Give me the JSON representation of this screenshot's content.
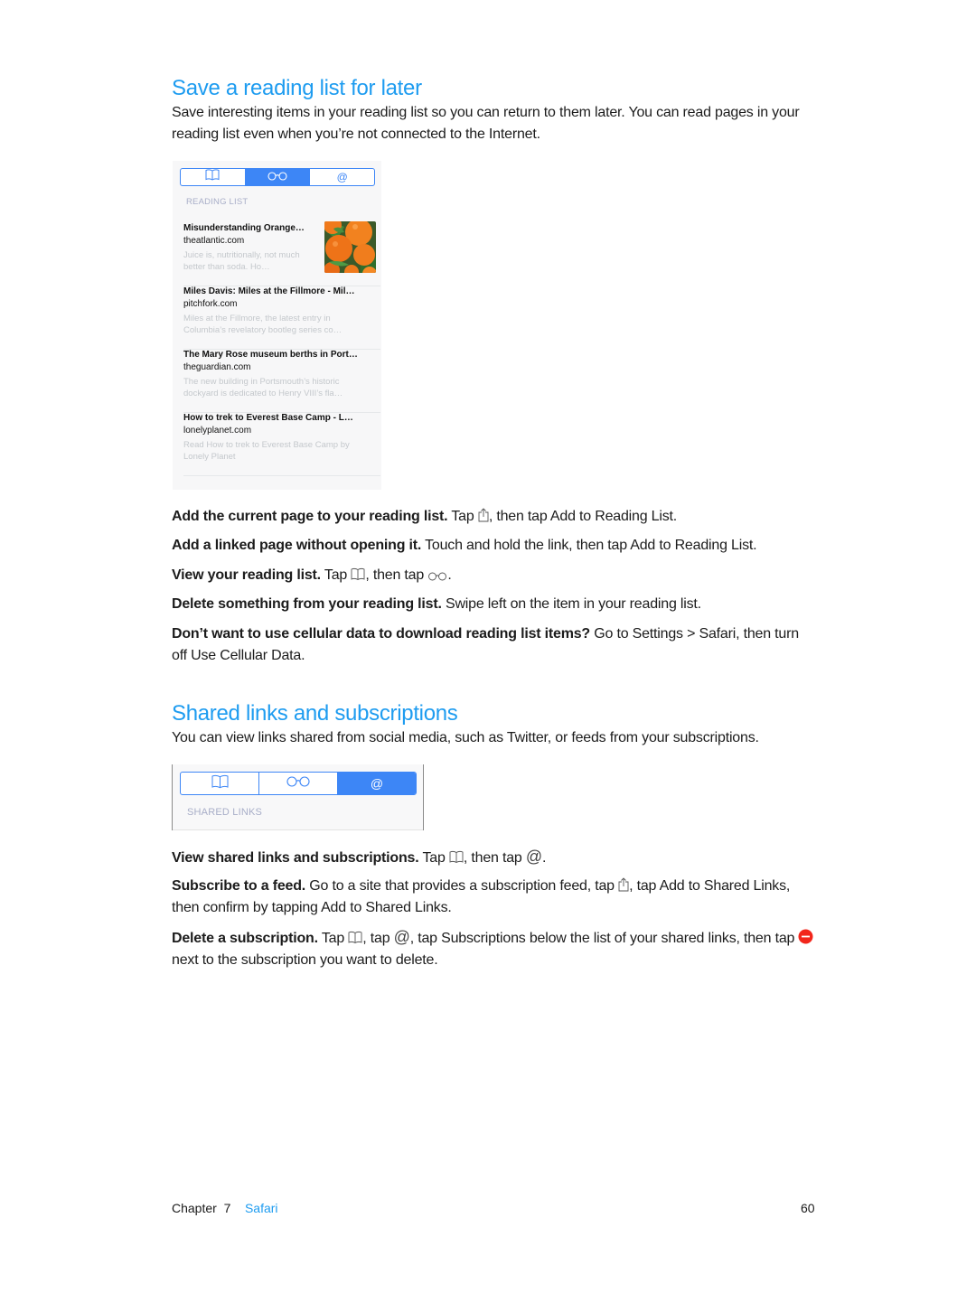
{
  "section1": {
    "title": "Save a reading list for later",
    "intro": "Save interesting items in your reading list so you can return to them later. You can read pages in your reading list even when you’re not connected to the Internet."
  },
  "reading_list_screen": {
    "tabs": [
      {
        "icon": "bookmarks-book-icon",
        "active": false
      },
      {
        "icon": "reading-list-glasses-icon",
        "active": true
      },
      {
        "icon": "shared-links-at-icon",
        "label": "@",
        "active": false
      }
    ],
    "section_label": "READING LIST",
    "items": [
      {
        "title": "Misunderstanding Orange…",
        "domain": "theatlantic.com",
        "snippet": "Juice is, nutritionally, not much better than soda. Ho…",
        "has_thumbnail": true
      },
      {
        "title": "Miles Davis: Miles at the Fillmore - Mil…",
        "domain": "pitchfork.com",
        "snippet": "Miles at the Fillmore, the latest entry in Columbia’s revelatory bootleg series co…",
        "has_thumbnail": false
      },
      {
        "title": "The Mary Rose museum berths in Port…",
        "domain": "theguardian.com",
        "snippet": "The new building in Portsmouth’s historic dockyard is dedicated to Henry VIII’s fla…",
        "has_thumbnail": false
      },
      {
        "title": "How to trek to Everest Base Camp - L…",
        "domain": "lonelyplanet.com",
        "snippet": "Read How to trek to Everest Base Camp by Lonely Planet",
        "has_thumbnail": false
      }
    ]
  },
  "tips1": [
    {
      "bold": "Add the current page to your reading list.",
      "pre": " Tap ",
      "icon": "share-icon",
      "post": ", then tap Add to Reading List."
    },
    {
      "bold": "Add a linked page without opening it.",
      "text": " Touch and hold the link, then tap Add to Reading List."
    },
    {
      "bold": "View your reading list.",
      "pre": " Tap ",
      "icon": "bookmarks-book-icon",
      "mid": ", then tap ",
      "icon2": "reading-list-glasses-icon",
      "post": "."
    },
    {
      "bold": "Delete something from your reading list.",
      "text": " Swipe left on the item in your reading list."
    },
    {
      "bold": "Don’t want to use cellular data to download reading list items?",
      "text": " Go to Settings > Safari, then turn off Use Cellular Data."
    }
  ],
  "section2": {
    "title": "Shared links and subscriptions",
    "intro": "You can view links shared from social media, such as Twitter, or feeds from your subscriptions."
  },
  "shared_links_screen": {
    "tabs": [
      {
        "icon": "bookmarks-book-icon",
        "active": false
      },
      {
        "icon": "reading-list-glasses-icon",
        "active": false
      },
      {
        "icon": "shared-links-at-icon",
        "label": "@",
        "active": true
      }
    ],
    "section_label": "SHARED LINKS"
  },
  "tips2": [
    {
      "bold": "View shared links and subscriptions.",
      "pre": " Tap ",
      "mid": ", then tap ",
      "at": "@",
      "post": "."
    },
    {
      "bold": "Subscribe to a feed.",
      "pre": " Go to a site that provides a subscription feed, tap ",
      "post": ", tap Add to Shared Links, then confirm by tapping Add to Shared Links."
    },
    {
      "bold": "Delete a subscription.",
      "pre": " Tap ",
      "mid": ", tap ",
      "at": "@",
      "mid2": ", tap Subscriptions below the list of your shared links, then tap ",
      "post": " next to the subscription you want to delete."
    }
  ],
  "footer": {
    "chapter_label": "Chapter",
    "chapter_number": "7",
    "chapter_name": "Safari",
    "page_number": "60"
  },
  "colors": {
    "heading_blue": "#1e9cf0",
    "ios_tint": "#3d86f6",
    "delete_red": "#f2261b"
  }
}
